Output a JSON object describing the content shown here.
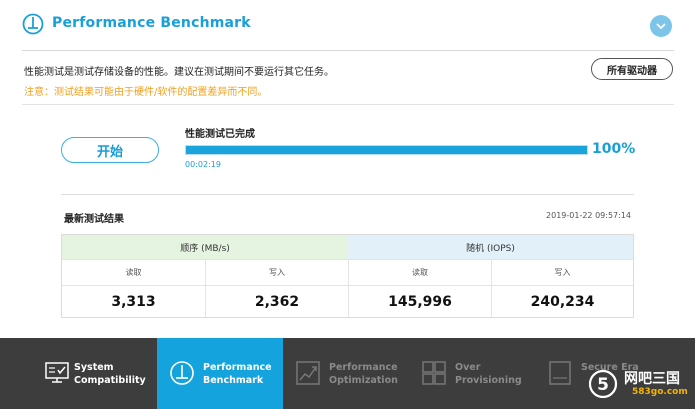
{
  "header": {
    "title": "Performance Benchmark",
    "icon": "gauge-icon",
    "collapse_icon": "chevron-down-icon",
    "accent_color": "#1aa0d8"
  },
  "info": {
    "description": "性能测试是测试存储设备的性能。建议在测试期间不要运行其它任务。",
    "note": "注意：测试结果可能由于硬件/软件的配置差异而不同。",
    "drives_button": "所有驱动器"
  },
  "test": {
    "start_button": "开始",
    "status": "性能测试已完成",
    "progress": 100,
    "progress_label": "100%",
    "elapsed": "00:02:19"
  },
  "results": {
    "title": "最新测试结果",
    "timestamp": "2019-01-22 09:57:14",
    "sequential": {
      "label": "顺序 (MB/s)",
      "read_label": "读取",
      "write_label": "写入",
      "read": "3,313",
      "write": "2,362"
    },
    "random": {
      "label": "随机 (IOPS)",
      "read_label": "读取",
      "write_label": "写入",
      "read": "145,996",
      "write": "240,234"
    }
  },
  "nav": {
    "items": [
      {
        "label": "System\nCompatibility",
        "icon": "monitor-check-icon",
        "active": false
      },
      {
        "label": "Performance\nBenchmark",
        "icon": "gauge-icon",
        "active": true
      },
      {
        "label": "Performance\nOptimization",
        "icon": "chart-up-icon",
        "active": false
      },
      {
        "label": "Over\nProvisioning",
        "icon": "grid-icon",
        "active": false
      },
      {
        "label": "Secure Era",
        "icon": "ssd-icon",
        "active": false
      }
    ],
    "active_color": "#14a3dd",
    "bar_color": "#3d3d3d"
  },
  "watermark": {
    "text": "网吧三国",
    "sub": "583go.com"
  }
}
